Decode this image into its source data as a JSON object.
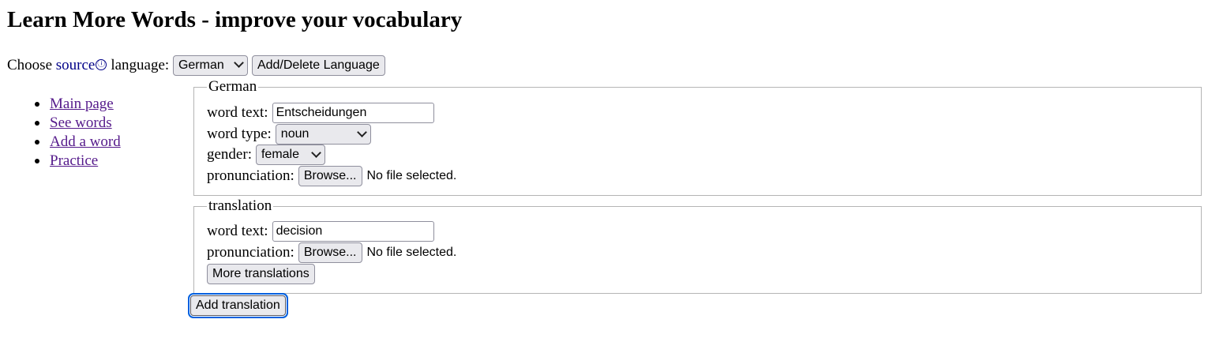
{
  "page": {
    "title": "Learn More Words - improve your vocabulary"
  },
  "language_bar": {
    "choose_label": "Choose",
    "source_link": "source",
    "info_icon": "info-circle-icon",
    "info_glyph": "ⓘ",
    "language_label": "language:",
    "selected_language": "German",
    "add_delete_button": "Add/Delete Language"
  },
  "nav": {
    "items": [
      {
        "label": "Main page"
      },
      {
        "label": "See words"
      },
      {
        "label": "Add a word"
      },
      {
        "label": "Practice"
      }
    ]
  },
  "source_form": {
    "legend": "German",
    "word_text_label": "word text:",
    "word_text_value": "Entscheidungen",
    "word_type_label": "word type:",
    "word_type_value": "noun",
    "gender_label": "gender:",
    "gender_value": "female",
    "pronunciation_label": "pronunciation:",
    "browse_button": "Browse...",
    "file_status": "No file selected."
  },
  "translation_form": {
    "legend": "translation",
    "word_text_label": "word text:",
    "word_text_value": "decision",
    "pronunciation_label": "pronunciation:",
    "browse_button": "Browse...",
    "file_status": "No file selected.",
    "more_translations_button": "More translations"
  },
  "actions": {
    "add_translation_button": "Add translation"
  },
  "colors": {
    "link_visited": "#551a8b",
    "source_link": "#000088",
    "focus_ring": "#0060df",
    "control_bg": "#e9e9ed"
  }
}
